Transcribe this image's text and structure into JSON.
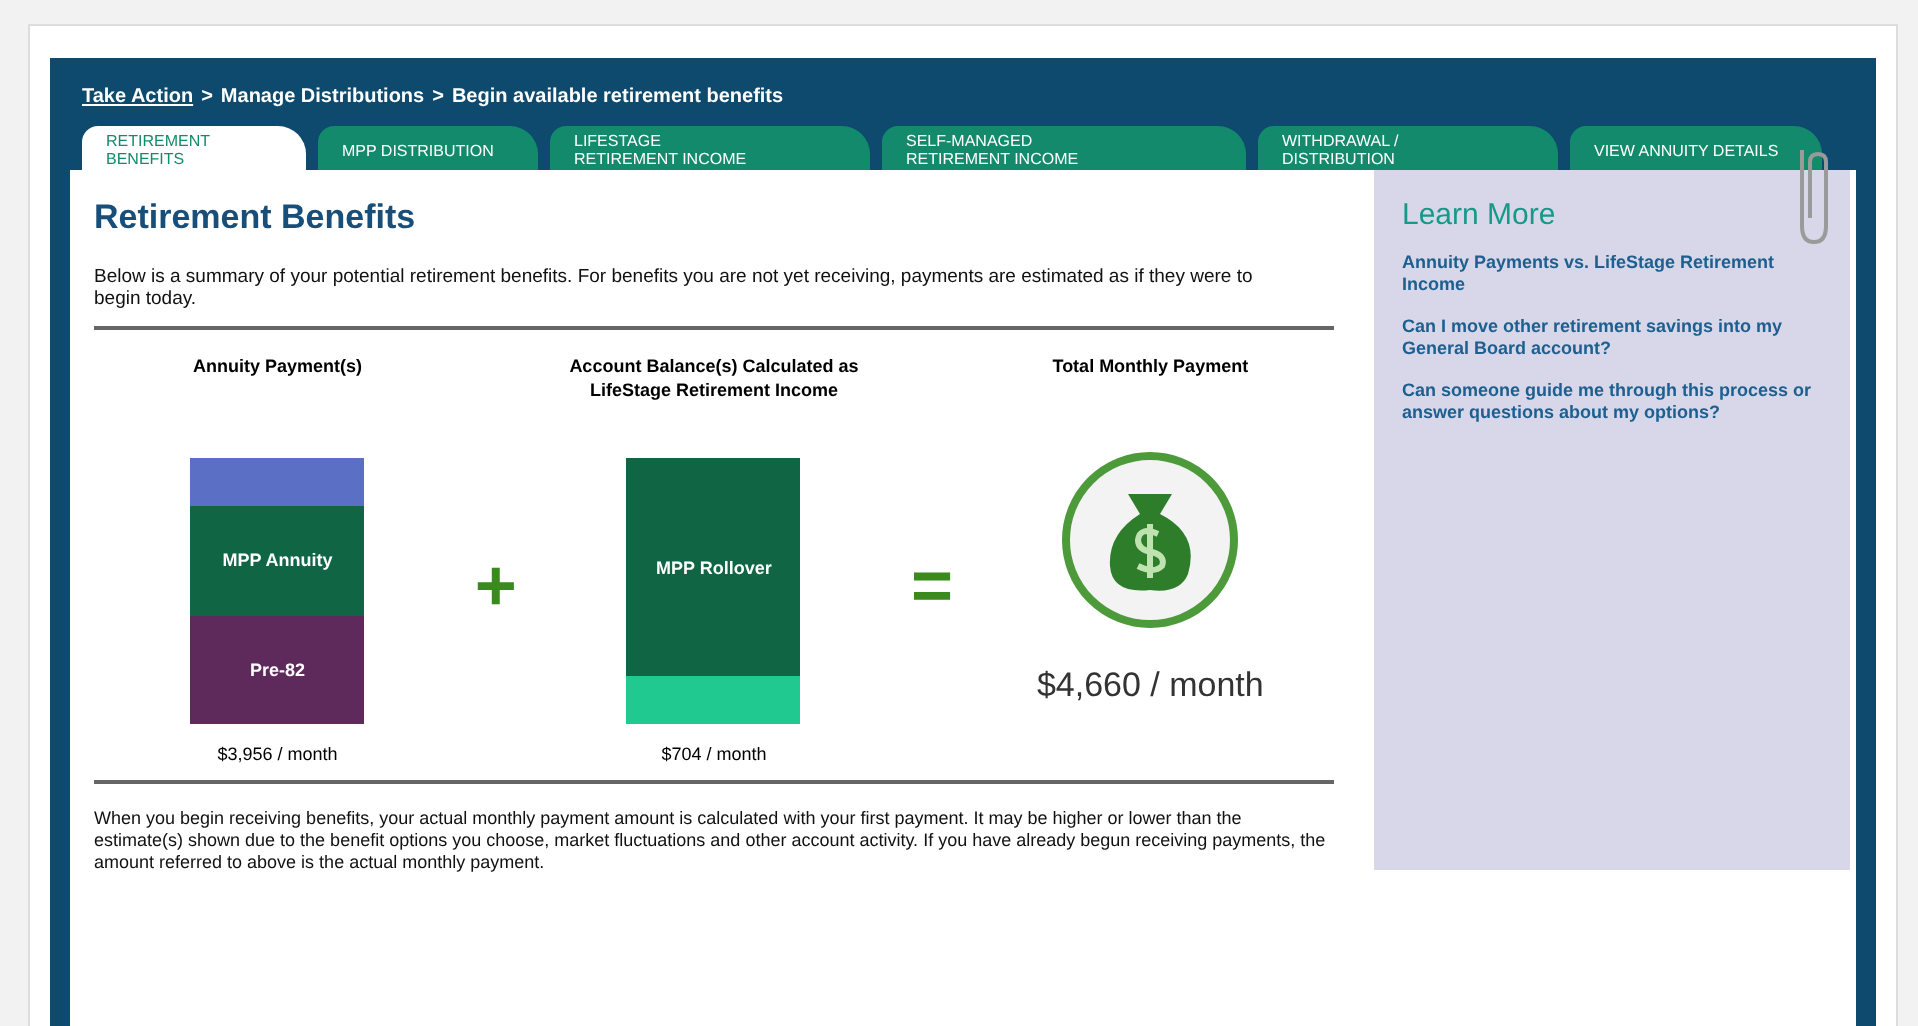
{
  "breadcrumb": [
    {
      "label": "Take Action",
      "link": true
    },
    {
      "label": ">",
      "link": false
    },
    {
      "label": "Manage Distributions",
      "link": false
    },
    {
      "label": ">",
      "link": false
    },
    {
      "label": "Begin available retirement benefits",
      "link": false
    }
  ],
  "tabs": [
    {
      "label": "RETIREMENT BENEFITS",
      "selected": true
    },
    {
      "label": "MPP DISTRIBUTION",
      "selected": false
    },
    {
      "label": "LIFESTAGE RETIREMENT INCOME",
      "selected": false
    },
    {
      "label": "SELF-MANAGED RETIREMENT INCOME",
      "selected": false
    },
    {
      "label": "WITHDRAWAL / DISTRIBUTION",
      "selected": false
    },
    {
      "label": "VIEW ANNUITY DETAILS",
      "selected": false
    }
  ],
  "heading": "Retirement Benefits",
  "intro": "Below is a summary of your potential retirement benefits. For benefits you are not yet receiving, payments are estimated as if they were to begin today.",
  "columns": [
    {
      "kind": "bar",
      "title": "Annuity Payment(s)",
      "amount": "$3,956 / month",
      "segments": [
        {
          "color": "#5b6fc4"
        },
        {
          "label": "MPP Annuity",
          "color": "#0f6544"
        },
        {
          "label": "Pre-82",
          "color": "#5e2a5c"
        }
      ]
    },
    {
      "kind": "operator",
      "symbol": "+"
    },
    {
      "kind": "bar",
      "title": "Account Balance(s) Calculated as LifeStage Retirement Income",
      "amount": "$704 / month",
      "segments": [
        {
          "label": "MPP Rollover",
          "color": "#0f6544"
        },
        {
          "color": "#1fc98f"
        }
      ]
    },
    {
      "kind": "operator",
      "symbol": "="
    },
    {
      "kind": "total",
      "title": "Total Monthly Payment",
      "amount": "$4,660 / month"
    }
  ],
  "footnote": "When you begin receiving benefits, your actual monthly payment amount is calculated with your first payment. It may be higher or lower than the estimate(s) shown due to the benefit options you choose, market fluctuations and other account activity. If you have already begun receiving payments, the amount referred to above is the actual monthly payment.",
  "learn_more": {
    "title": "Learn More",
    "links": [
      "Annuity Payments vs. LifeStage Retirement Income",
      "Can I move other retirement savings into my General Board account?",
      "Can someone guide me through this process or answer questions about my options?"
    ]
  }
}
